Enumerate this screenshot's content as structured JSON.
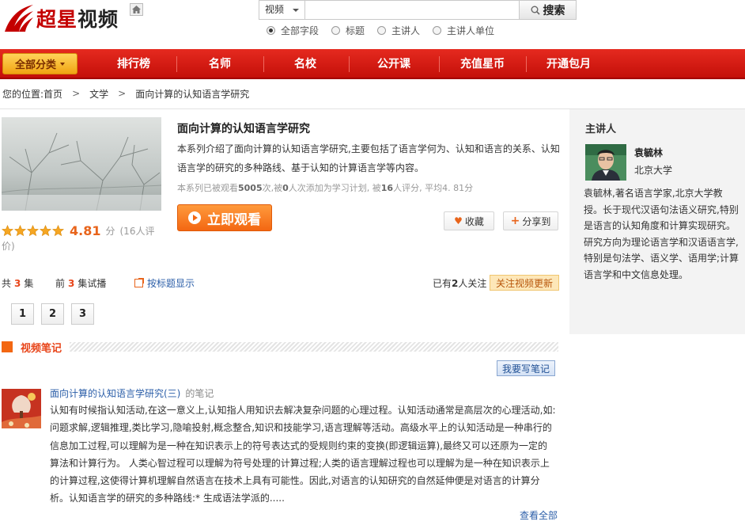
{
  "header": {
    "logo_red": "超星",
    "logo_dark": "视频",
    "search": {
      "scope": "视频",
      "query": "",
      "button": "搜索",
      "options": [
        {
          "label": "全部字段",
          "selected": true
        },
        {
          "label": "标题",
          "selected": false
        },
        {
          "label": "主讲人",
          "selected": false
        },
        {
          "label": "主讲人单位",
          "selected": false
        }
      ]
    }
  },
  "nav": {
    "all": "全部分类",
    "items": [
      "排行榜",
      "名师",
      "名校",
      "公开课",
      "充值星币",
      "开通包月"
    ]
  },
  "breadcrumb": {
    "prefix": "您的位置:",
    "items": [
      "首页",
      "文学",
      "面向计算的认知语言学研究"
    ]
  },
  "course": {
    "title": "面向计算的认知语言学研究",
    "description": "本系列介绍了面向计算的认知语言学研究,主要包括了语言学何为、认知和语言的关系、认知语言学的研究的多种路线、基于认知的计算语言学等内容。",
    "stats": {
      "p1": "本系列已被观看",
      "views": "5005",
      "p2": "次,被",
      "plans": "0",
      "p3": "人次添加为学习计划,   被",
      "raters": "16",
      "p4": "人评分,  平均4. 81分"
    },
    "rating": {
      "value": "4.81",
      "unit": "分",
      "count_a": "(16人评",
      "count_b": "价)",
      "stars": 5
    },
    "watch": "立即观看",
    "fav": "收藏",
    "share": "分享到"
  },
  "episodes": {
    "total_a": "共",
    "total": "3",
    "total_b": "集",
    "trial_a": "前",
    "trial": "3",
    "trial_b": "集试播",
    "mode": "按标题显示",
    "follow_a": "已有",
    "follow_n": "2",
    "follow_b": "人关注",
    "follow_btn": "关注视频更新",
    "items": [
      "1",
      "2",
      "3"
    ]
  },
  "notes": {
    "heading": "视频笔记",
    "write": "我要写笔记",
    "note": {
      "title": "面向计算的认知语言学研究(三)",
      "suffix": "的笔记",
      "body": "认知有时候指认知活动,在这一意义上,认知指人用知识去解决复杂问题的心理过程。认知活动通常是高层次的心理活动,如:问题求解,逻辑推理,类比学习,隐喻投射,概念整合,知识和技能学习,语言理解等活动。高级水平上的认知活动是一种串行的信息加工过程,可以理解为是一种在知识表示上的符号表达式的受规则约束的变换(即逻辑运算),最终又可以还原为一定的算法和计算行为。            人类心智过程可以理解为符号处理的计算过程;人类的语言理解过程也可以理解为是一种在知识表示上的计算过程,这使得计算机理解自然语言在技术上具有可能性。因此,对语言的认知研究的自然延伸便是对语言的计算分析。认知语言学的研究的多种路线:* 生成语法学派的.....",
      "view_all": "查看全部"
    }
  },
  "sidebar": {
    "title": "主讲人",
    "name": "袁毓林",
    "org": "北京大学",
    "bio": "袁毓林,著名语言学家,北京大学教授。长于现代汉语句法语义研究,特别是语言的认知角度和计算实现研究。研究方向为理论语言学和汉语语言学,特别是句法学、语义学、语用学;计算语言学和中文信息处理。"
  },
  "colors": {
    "nav_red": "#d4170f",
    "accent_orange": "#f36712",
    "link_blue": "#2b5ea8"
  }
}
